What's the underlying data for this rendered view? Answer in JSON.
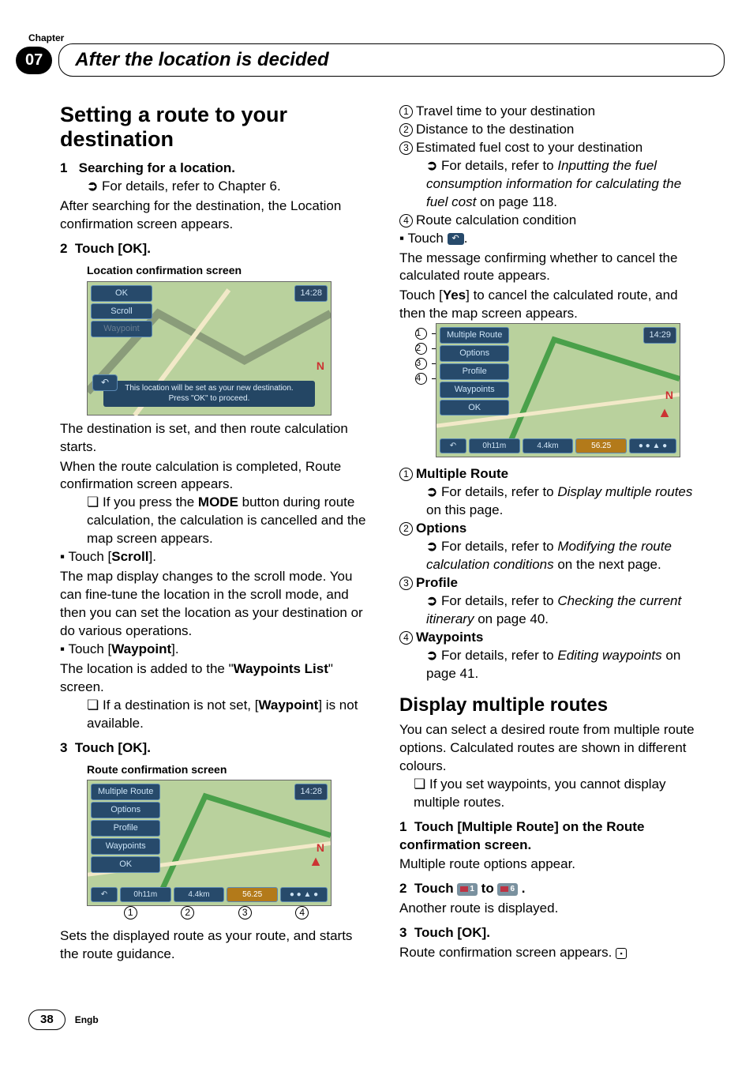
{
  "chapter": {
    "label": "Chapter",
    "number": "07",
    "title": "After the location is decided"
  },
  "left": {
    "h1": "Setting a route to your destination",
    "step1_num": "1",
    "step1_title": "Searching for a location.",
    "step1_ref": "For details, refer to Chapter 6.",
    "step1_body": "After searching for the destination, the Location confirmation screen appears.",
    "step2_num": "2",
    "step2_title": "Touch [OK].",
    "loc_caption": "Location confirmation screen",
    "loc_map": {
      "ok": "OK",
      "scroll": "Scroll",
      "waypoint": "Waypoint",
      "time": "14:28",
      "banner1": "This location will be set as your new destination.",
      "banner2": "Press \"OK\" to proceed.",
      "compass": "N",
      "back": "↶"
    },
    "step2_body1": "The destination is set, and then route calculation starts.",
    "step2_body2": "When the route calculation is completed, Route confirmation screen appears.",
    "step2_note_mode": "If you press the ",
    "step2_note_mode_b": "MODE",
    "step2_note_mode2": " button during route calculation, the calculation is cancelled and the map screen appears.",
    "touch_scroll": "Touch [",
    "touch_scroll_b": "Scroll",
    "touch_scroll2": "].",
    "scroll_body": "The map display changes to the scroll mode. You can fine-tune the location in the scroll mode, and then you can set the location as your destination or do various operations.",
    "touch_wp": "Touch [",
    "touch_wp_b": "Waypoint",
    "touch_wp2": "].",
    "wp_body1": "The location is added to the \"",
    "wp_body_b": "Waypoints List",
    "wp_body2": "\" screen.",
    "wp_note": "If a destination is not set, [",
    "wp_note_b": "Waypoint",
    "wp_note2": "] is not available.",
    "step3_num": "3",
    "step3_title": "Touch [OK].",
    "route_caption": "Route confirmation screen",
    "route_map": {
      "multiple": "Multiple Route",
      "options": "Options",
      "profile": "Profile",
      "waypoints": "Waypoints",
      "ok": "OK",
      "time": "14:28",
      "back": "↶",
      "cell1": "0h11m",
      "cell2": "4.4km",
      "cell3": "56.25",
      "compass": "N"
    },
    "callouts": {
      "c1": "1",
      "c2": "2",
      "c3": "3",
      "c4": "4"
    },
    "step3_body": "Sets the displayed route as your route, and starts the route guidance."
  },
  "right": {
    "list": {
      "c1": "Travel time to your destination",
      "c2": "Distance to the destination",
      "c3": "Estimated fuel cost to your destination",
      "c3_ref1": "For details, refer to ",
      "c3_ref_i": "Inputting the fuel consumption information for calculating the fuel cost",
      "c3_ref2": " on page 118.",
      "c4": "Route calculation condition"
    },
    "touch_back": "Touch ",
    "touch_back2": ".",
    "back_body1": "The message confirming whether to cancel the calculated route appears.",
    "back_body2a": "Touch [",
    "back_body2b": "Yes",
    "back_body2c": "] to cancel the calculated route, and then the map screen appears.",
    "map": {
      "multiple": "Multiple Route",
      "options": "Options",
      "profile": "Profile",
      "waypoints": "Waypoints",
      "ok": "OK",
      "time": "14:29",
      "back": "↶",
      "cell1": "0h11m",
      "cell2": "4.4km",
      "cell3": "56.25",
      "compass": "N"
    },
    "side_callouts": {
      "c1": "1",
      "c2": "2",
      "c3": "3",
      "c4": "4"
    },
    "defs": {
      "n1": "1",
      "t1": "Multiple Route",
      "r1a": "For details, refer to ",
      "r1i": "Display multiple routes",
      "r1b": " on this page.",
      "n2": "2",
      "t2": "Options",
      "r2a": "For details, refer to ",
      "r2i": "Modifying the route calculation conditions",
      "r2b": " on the next page.",
      "n3": "3",
      "t3": "Profile",
      "r3a": "For details, refer to ",
      "r3i": "Checking the current itinerary",
      "r3b": " on page 40.",
      "n4": "4",
      "t4": "Waypoints",
      "r4a": "For details, refer to ",
      "r4i": "Editing waypoints",
      "r4b": " on page 41."
    },
    "h2": "Display multiple routes",
    "h2_body": "You can select a desired route from multiple route options. Calculated routes are shown in different colours.",
    "h2_note": "If you set waypoints, you cannot display multiple routes.",
    "s1_num": "1",
    "s1": "Touch [Multiple Route] on the Route confirmation screen.",
    "s1_body": "Multiple route options appear.",
    "s2_num": "2",
    "s2a": "Touch ",
    "s2_img1": "1",
    "s2b": " to ",
    "s2_img6": "6",
    "s2c": ".",
    "s2_body": "Another route is displayed.",
    "s3_num": "3",
    "s3": "Touch [OK].",
    "s3_body": "Route confirmation screen appears.",
    "end": "▪"
  },
  "footer": {
    "page": "38",
    "lang": "Engb"
  }
}
